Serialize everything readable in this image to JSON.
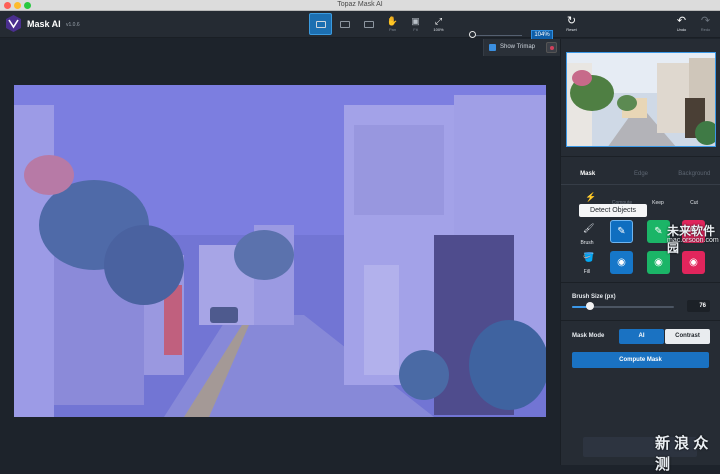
{
  "window": {
    "title": "Topaz Mask AI"
  },
  "app": {
    "name": "Mask AI",
    "version": "v1.0.6"
  },
  "toolbar": {
    "view_single_icon": "single-view-icon",
    "view_split_icon": "split-view-icon",
    "view_side_icon": "side-by-side-icon",
    "pan_label": "Pan",
    "fit_label": "Fit",
    "zoom100_label": "100%",
    "zoom_value": "104%",
    "reset_label": "Reset",
    "undo_label": "Undo",
    "redo_label": "Redo"
  },
  "trimap": {
    "label": "Show Trimap",
    "checked": true
  },
  "panel": {
    "tabs": [
      "Mask",
      "Edge",
      "Background"
    ],
    "tools": {
      "compute_label": "Compute",
      "keep_label": "Keep",
      "cut_label": "Cut"
    },
    "tooltip": "Detect Objects",
    "brush_label": "Brush",
    "fill_label": "Fill",
    "brush_size_label": "Brush Size (px)",
    "brush_size_value": "76",
    "brush_size_fraction": 0.18,
    "mask_mode_label": "Mask Mode",
    "mask_mode_ai": "AI",
    "mask_mode_contrast": "Contrast",
    "compute_mask_label": "Compute Mask"
  },
  "watermark": {
    "line1": "未来软件园",
    "line2": "mac.orsoon.com",
    "corner": "新 浪 众 测"
  },
  "colors": {
    "accent": "#1a72c2",
    "compute": "#0f6ec0",
    "keep": "#1bb567",
    "cut": "#e1255c"
  }
}
